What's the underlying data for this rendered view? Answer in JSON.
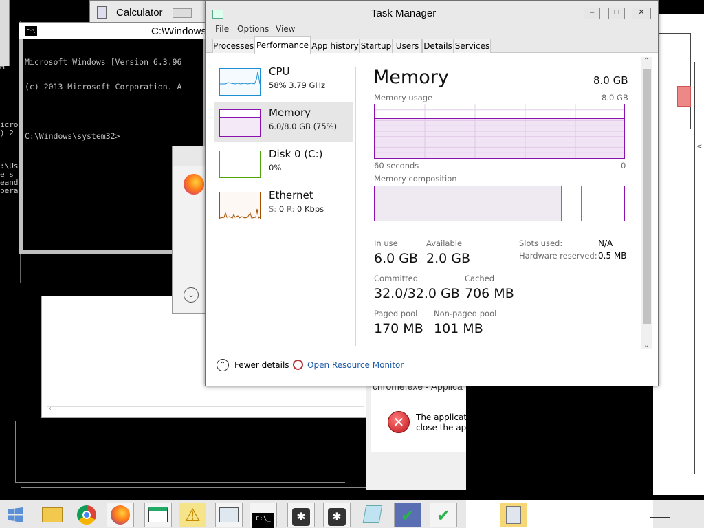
{
  "calculator": {
    "title": "Calculator"
  },
  "cmd": {
    "title": "C:\\Windows",
    "line1": "Microsoft Windows [Version 6.3.96",
    "line2": "(c) 2013 Microsoft Corporation. A",
    "line3": "C:\\Windows\\system32>",
    "back_lines": [
      "M",
      "M",
      "",
      "",
      "",
      "icro",
      ") 2",
      "",
      ":\\Us",
      "e s",
      "eand",
      "pera"
    ]
  },
  "error_dialog": {
    "title": "chrome.exe - Applica",
    "message_line1": "The applicatio",
    "message_line2": "close the appl"
  },
  "task_manager": {
    "title": "Task Manager",
    "menu": [
      "File",
      "Options",
      "View"
    ],
    "tabs": [
      "Processes",
      "Performance",
      "App history",
      "Startup",
      "Users",
      "Details",
      "Services"
    ],
    "active_tab": "Performance",
    "sidebar": [
      {
        "title": "CPU",
        "sub": "58%  3.79 GHz",
        "color": "#1b8fd2"
      },
      {
        "title": "Memory",
        "sub": "6.0/8.0 GB (75%)",
        "color": "#8b12ae"
      },
      {
        "title": "Disk 0 (C:)",
        "sub": "0%",
        "color": "#4da60c"
      },
      {
        "title": "Ethernet",
        "sub_prefix": "S:",
        "sub_s": "0",
        "sub_r_label": "R:",
        "sub_r": "0 Kbps",
        "color": "#a74f01"
      }
    ],
    "memory": {
      "heading": "Memory",
      "total": "8.0 GB",
      "usage_label": "Memory usage",
      "usage_max": "8.0 GB",
      "time_span": "60 seconds",
      "time_end": "0",
      "usage_fraction": 0.75,
      "composition_label": "Memory composition",
      "composition_fractions": {
        "in_use": 0.75,
        "modified": 0.08,
        "standby": 0.17
      },
      "in_use_label": "In use",
      "in_use": "6.0 GB",
      "available_label": "Available",
      "available": "2.0 GB",
      "committed_label": "Committed",
      "committed": "32.0/32.0 GB",
      "cached_label": "Cached",
      "cached": "706 MB",
      "paged_pool_label": "Paged pool",
      "paged_pool": "170 MB",
      "nonpaged_pool_label": "Non-paged pool",
      "nonpaged_pool": "101 MB",
      "slots_used_label": "Slots used:",
      "slots_used": "N/A",
      "hw_reserved_label": "Hardware reserved:",
      "hw_reserved": "0.5 MB"
    },
    "footer": {
      "fewer_details": "Fewer details",
      "open_resource_monitor": "Open Resource Monitor"
    },
    "accent": "#8b12ae"
  },
  "taskbar": {
    "icons": [
      "start-icon",
      "file-explorer-icon",
      "chrome-icon",
      "firefox-icon",
      "window-app-icon",
      "warning-icon",
      "performance-monitor-icon",
      "cmd-icon",
      "bug-icon",
      "bug-icon-2",
      "notepad-icon",
      "security-check-icon",
      "security-check-icon-2",
      "calculator-icon"
    ]
  }
}
